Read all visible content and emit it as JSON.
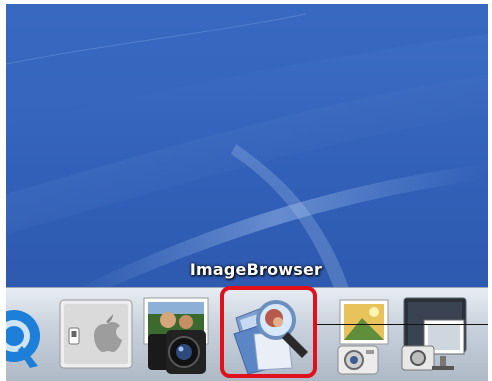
{
  "dock": {
    "tooltip": "ImageBrowser",
    "items": [
      {
        "icon": "quicktime-icon"
      },
      {
        "icon": "system-preferences-icon"
      },
      {
        "icon": "camera-photo-icon"
      },
      {
        "icon": "imagebrowser-icon",
        "selected": true
      },
      {
        "icon": "image-capture-icon"
      },
      {
        "icon": "photo-display-icon"
      }
    ]
  },
  "colors": {
    "highlight": "#e0101c",
    "desktop": "#3260b8"
  }
}
